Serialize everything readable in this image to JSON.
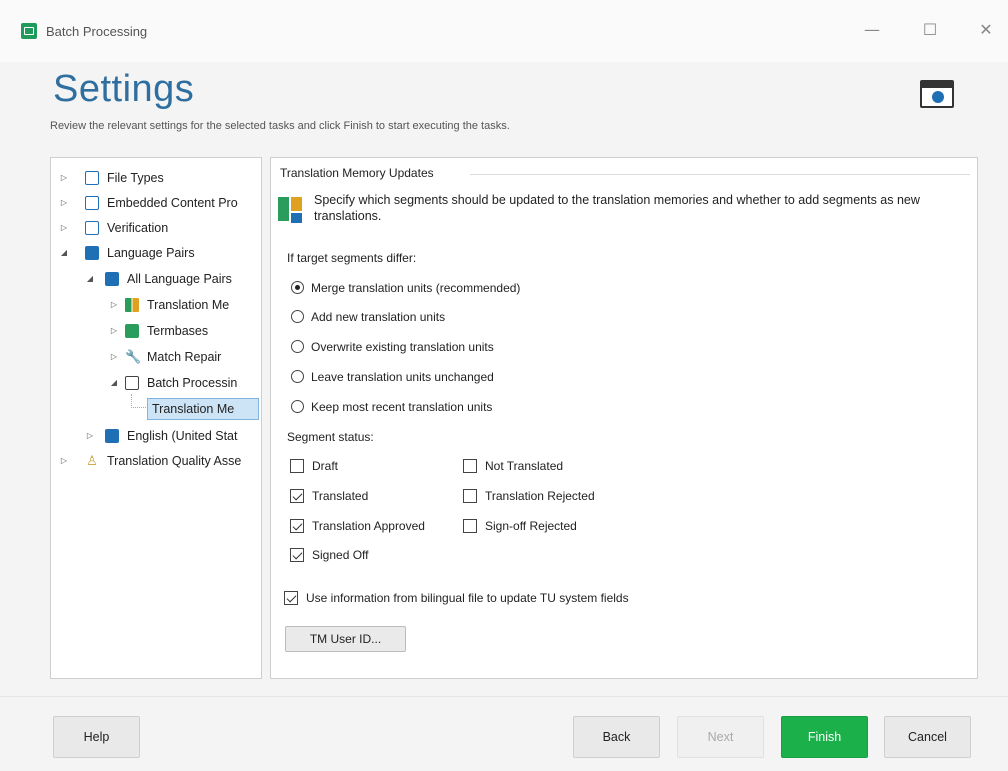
{
  "window": {
    "title": "Batch Processing",
    "controls": {
      "minimize": "—",
      "maximize": "☐",
      "close": "✕"
    }
  },
  "header": {
    "title": "Settings",
    "subtitle": "Review the relevant settings for the selected tasks and click Finish to start executing the tasks."
  },
  "tree": {
    "items": [
      {
        "label": "File Types",
        "icon": "document-settings-icon"
      },
      {
        "label": "Embedded Content Pro",
        "icon": "document-settings-icon"
      },
      {
        "label": "Verification",
        "icon": "verification-icon"
      },
      {
        "label": "Language Pairs",
        "icon": "language-pairs-icon"
      },
      {
        "label": "All Language Pairs",
        "icon": "language-pairs-icon"
      },
      {
        "label": "Translation Me",
        "icon": "translation-memory-icon"
      },
      {
        "label": "Termbases",
        "icon": "termbase-icon"
      },
      {
        "label": "Match Repair",
        "icon": "wrench-icon"
      },
      {
        "label": "Batch Processin",
        "icon": "batch-processing-icon"
      },
      {
        "label": "Translation Me",
        "icon": "",
        "selected": true
      },
      {
        "label": "English (United Stat",
        "icon": "language-pairs-icon"
      },
      {
        "label": "Translation Quality Asse",
        "icon": "person-icon"
      }
    ]
  },
  "panel": {
    "group_title": "Translation Memory Updates",
    "description": "Specify which segments should be updated to the translation memories and whether to add segments as new translations.",
    "target_differ_label": "If target segments differ:",
    "radio_options": [
      {
        "label": "Merge translation units (recommended)",
        "selected": true
      },
      {
        "label": "Add new translation units",
        "selected": false
      },
      {
        "label": "Overwrite existing translation units",
        "selected": false
      },
      {
        "label": "Leave translation units unchanged",
        "selected": false
      },
      {
        "label": "Keep most recent translation units",
        "selected": false
      }
    ],
    "segment_status_label": "Segment status:",
    "status_left": [
      {
        "label": "Draft",
        "checked": false
      },
      {
        "label": "Translated",
        "checked": true
      },
      {
        "label": "Translation Approved",
        "checked": true
      },
      {
        "label": "Signed Off",
        "checked": true
      }
    ],
    "status_right": [
      {
        "label": "Not Translated",
        "checked": false
      },
      {
        "label": "Translation Rejected",
        "checked": false
      },
      {
        "label": "Sign-off Rejected",
        "checked": false
      }
    ],
    "bilingual_option": {
      "label": "Use information from bilingual file to update TU system fields",
      "checked": true
    },
    "tm_user_button": "TM User ID..."
  },
  "footer": {
    "help": "Help",
    "back": "Back",
    "next": "Next",
    "finish": "Finish",
    "cancel": "Cancel"
  },
  "colors": {
    "title_blue": "#2f6fa0",
    "finish_green": "#1bb04a",
    "selection_blue": "#cde4f7"
  }
}
